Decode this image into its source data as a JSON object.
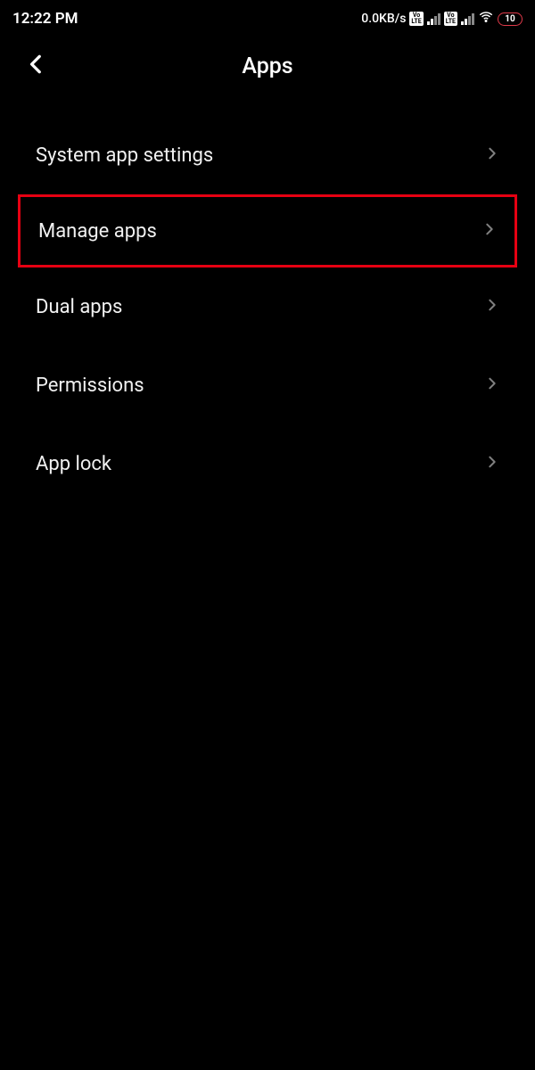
{
  "status_bar": {
    "time": "12:22 PM",
    "net_speed": "0.0KB/s",
    "battery_percent": "10"
  },
  "header": {
    "title": "Apps"
  },
  "menu": {
    "items": [
      {
        "label": "System app settings",
        "highlighted": false
      },
      {
        "label": "Manage apps",
        "highlighted": true
      },
      {
        "label": "Dual apps",
        "highlighted": false
      },
      {
        "label": "Permissions",
        "highlighted": false
      },
      {
        "label": "App lock",
        "highlighted": false
      }
    ]
  }
}
